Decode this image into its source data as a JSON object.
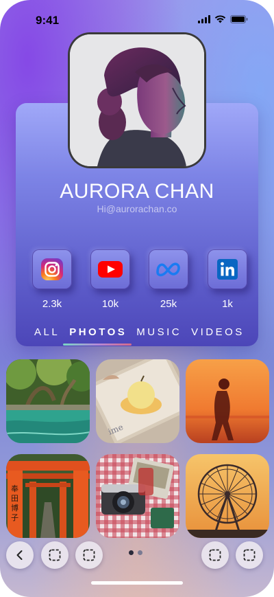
{
  "status_bar": {
    "time": "9:41"
  },
  "profile": {
    "name": "AURORA CHAN",
    "email": "Hi@aurorachan.co"
  },
  "social": [
    {
      "icon": "instagram-icon",
      "count": "2.3k",
      "color": "#e4405f"
    },
    {
      "icon": "youtube-icon",
      "count": "10k",
      "color": "#ff0000"
    },
    {
      "icon": "meta-icon",
      "count": "25k",
      "color": "#1877f2"
    },
    {
      "icon": "linkedin-icon",
      "count": "1k",
      "color": "#0a66c2"
    }
  ],
  "tabs": [
    {
      "label": "ALL",
      "active": false
    },
    {
      "label": "PHOTOS",
      "active": true
    },
    {
      "label": "MUSIC",
      "active": false
    },
    {
      "label": "VIDEOS",
      "active": false
    }
  ],
  "gallery": [
    {
      "subject": "river-forest-photo"
    },
    {
      "subject": "dessert-plate-photo"
    },
    {
      "subject": "silhouette-sunset-photo"
    },
    {
      "subject": "torii-gates-photo"
    },
    {
      "subject": "camera-picnic-photo"
    },
    {
      "subject": "ferris-wheel-photo"
    }
  ],
  "bottom_bar": {
    "buttons": [
      "back-icon",
      "select-icon",
      "select-icon",
      "select-icon",
      "select-icon"
    ],
    "page_count": 2,
    "current_page": 1
  },
  "colors": {
    "accent_purple": "#5f5fcc",
    "underline_gradient": [
      "#7ad7c4",
      "#b48ad8",
      "#d46a8a"
    ]
  }
}
